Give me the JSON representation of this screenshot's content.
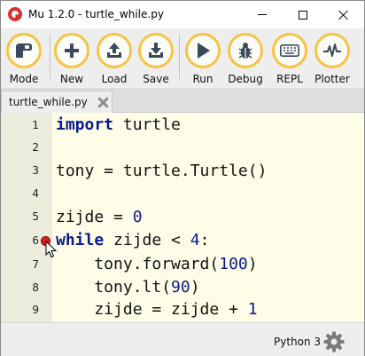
{
  "window": {
    "title": "Mu 1.2.0 - turtle_while.py"
  },
  "toolbar": {
    "buttons": [
      {
        "label": "Mode",
        "icon": "mode-icon"
      },
      {
        "label": "New",
        "icon": "plus-icon"
      },
      {
        "label": "Load",
        "icon": "upload-icon"
      },
      {
        "label": "Save",
        "icon": "download-icon"
      },
      {
        "label": "Run",
        "icon": "play-icon"
      },
      {
        "label": "Debug",
        "icon": "bug-icon"
      },
      {
        "label": "REPL",
        "icon": "keyboard-icon"
      },
      {
        "label": "Plotter",
        "icon": "pulse-icon"
      }
    ],
    "accent_color": "#f6c445"
  },
  "tabs": [
    {
      "label": "turtle_while.py",
      "active": true
    }
  ],
  "editor": {
    "line_numbers": [
      "1",
      "2",
      "3",
      "4",
      "5",
      "6",
      "7",
      "8",
      "9"
    ],
    "lines": [
      {
        "kw": "import",
        "rest": " turtle"
      },
      {
        "kw": "",
        "rest": ""
      },
      {
        "kw": "",
        "rest": "tony = turtle.Turtle()"
      },
      {
        "kw": "",
        "rest": ""
      },
      {
        "kw": "",
        "rest": "zijde = 0"
      },
      {
        "kw": "while",
        "rest": " zijde < 4:"
      },
      {
        "kw": "",
        "rest": "    tony.forward(100)"
      },
      {
        "kw": "",
        "rest": "    tony.lt(90)"
      },
      {
        "kw": "",
        "rest": "    zijde = zijde + 1"
      }
    ],
    "code_parts": {
      "line3": "tony = turtle.Turtle()",
      "line5a": "zijde = ",
      "line5b": "0",
      "line6a": " zijde < ",
      "line6b": "4",
      "line6c": ":",
      "line7a": "    tony.forward(",
      "line7b": "100",
      "line7c": ")",
      "line8a": "    tony.lt(",
      "line8b": "90",
      "line8c": ")",
      "line9a": "    zijde = zijde + ",
      "line9b": "1"
    },
    "breakpoint_line": 6,
    "breakpoint_color": "#e0191d"
  },
  "status": {
    "mode": "Python 3",
    "settings_icon": "gear-icon"
  }
}
